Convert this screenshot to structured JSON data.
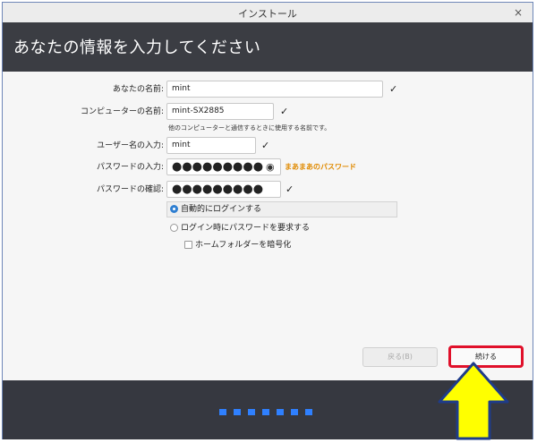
{
  "window": {
    "title": "インストール",
    "close_glyph": "×"
  },
  "header": {
    "title": "あなたの情報を入力してください"
  },
  "form": {
    "name_label": "あなたの名前:",
    "name_value": "mint",
    "computer_label": "コンピューターの名前:",
    "computer_value": "mint-SX2885",
    "computer_hint": "他のコンピューターと通信するときに使用する名前です。",
    "user_label": "ユーザー名の入力:",
    "user_value": "mint",
    "password_label": "パスワードの入力:",
    "password_value": "●●●●●●●●●",
    "password_strength": "まあまあのパスワード",
    "confirm_label": "パスワードの確認:",
    "confirm_value": "●●●●●●●●●",
    "check_glyph": "✓"
  },
  "options": {
    "auto_login": "自動的にログインする",
    "require_password": "ログイン時にパスワードを要求する",
    "encrypt_home": "ホームフォルダーを暗号化"
  },
  "buttons": {
    "back": "戻る(B)",
    "next": "続ける"
  },
  "progress": {
    "total_steps": 7
  },
  "colors": {
    "accent": "#2f7fd1",
    "highlight": "#e0102a",
    "arrow": "#ffff00"
  }
}
